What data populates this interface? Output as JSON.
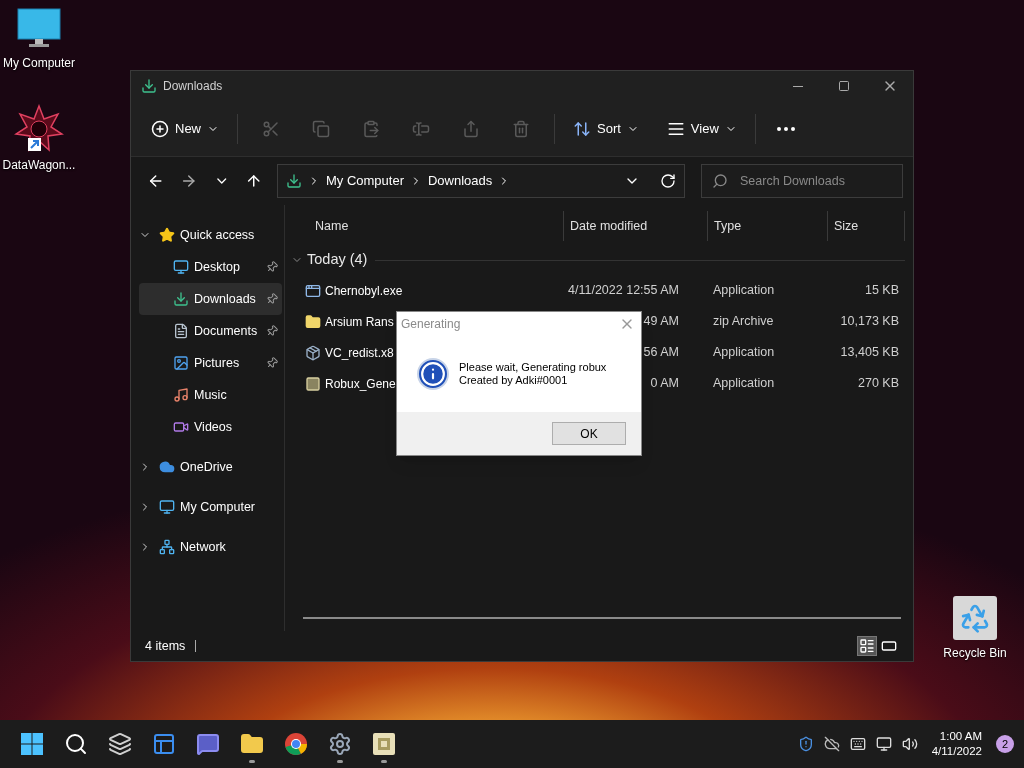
{
  "desktop_icons": [
    {
      "label": "My Computer",
      "kind": "monitor"
    },
    {
      "label": "DataWagon...",
      "kind": "shortcut"
    },
    {
      "label": "Recycle Bin",
      "kind": "recycle"
    }
  ],
  "window": {
    "title": "Downloads"
  },
  "toolbar": {
    "new": "New",
    "sort": "Sort",
    "view": "View"
  },
  "address": {
    "crumbs": [
      "My Computer",
      "Downloads"
    ],
    "search_placeholder": "Search Downloads"
  },
  "sidebar": {
    "items": [
      {
        "label": "Quick access",
        "kind": "star",
        "expanded": true,
        "selected": false,
        "children": [
          {
            "label": "Desktop",
            "kind": "desktop",
            "pinned": true,
            "selected": false
          },
          {
            "label": "Downloads",
            "kind": "download",
            "pinned": true,
            "selected": true
          },
          {
            "label": "Documents",
            "kind": "document",
            "pinned": true,
            "selected": false
          },
          {
            "label": "Pictures",
            "kind": "picture",
            "pinned": true,
            "selected": false
          },
          {
            "label": "Music",
            "kind": "music",
            "pinned": false,
            "selected": false
          },
          {
            "label": "Videos",
            "kind": "video",
            "pinned": false,
            "selected": false
          }
        ]
      },
      {
        "label": "OneDrive",
        "kind": "cloud",
        "expanded": false,
        "selected": false
      },
      {
        "label": "My Computer",
        "kind": "monitor",
        "expanded": false,
        "selected": false
      },
      {
        "label": "Network",
        "kind": "network",
        "expanded": false,
        "selected": false
      }
    ]
  },
  "table": {
    "columns": [
      "Name",
      "Date modified",
      "Type",
      "Size"
    ],
    "group": {
      "label": "Today (4)",
      "expanded": true
    },
    "rows": [
      {
        "name": "Chernobyl.exe",
        "kind": "exe",
        "date": "4/11/2022 12:55 AM",
        "type": "Application",
        "size": "15 KB"
      },
      {
        "name": "Arsium Rans",
        "kind": "zip",
        "date": "49 AM",
        "type": "zip Archive",
        "size": "10,173 KB"
      },
      {
        "name": "VC_redist.x8",
        "kind": "installer",
        "date": "56 AM",
        "type": "Application",
        "size": "13,405 KB"
      },
      {
        "name": "Robux_Gene",
        "kind": "app",
        "date": "0 AM",
        "type": "Application",
        "size": "270 KB"
      }
    ]
  },
  "status_bar": {
    "count": "4 items",
    "view_modes": [
      {
        "kind": "details",
        "selected": true
      },
      {
        "kind": "tiles",
        "selected": false
      }
    ]
  },
  "dialog": {
    "title": "Generating",
    "lines": [
      "Please wait, Generating robux",
      "Created by Adki#0001"
    ],
    "button": "OK"
  },
  "taskbar": {
    "apps": [
      {
        "kind": "start",
        "running": false
      },
      {
        "kind": "search",
        "running": false
      },
      {
        "kind": "taskview",
        "running": false
      },
      {
        "kind": "widgets",
        "running": false
      },
      {
        "kind": "chat",
        "running": false
      },
      {
        "kind": "explorer",
        "running": true
      },
      {
        "kind": "browser",
        "running": false
      },
      {
        "kind": "settings",
        "running": true
      },
      {
        "kind": "app",
        "running": true
      }
    ],
    "time": "1:00 AM",
    "date": "4/11/2022",
    "notifications": "2"
  }
}
